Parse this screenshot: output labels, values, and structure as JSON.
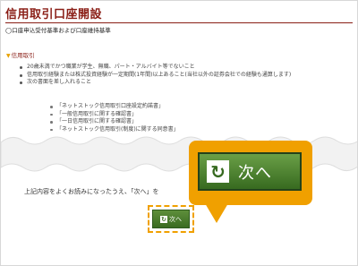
{
  "page": {
    "title": "信用取引口座開設",
    "subheading": "◯口座申込受付基準および口座維持基準"
  },
  "section": {
    "title": "信用取引",
    "marker_icon": "triangle-down-icon"
  },
  "criteria": [
    "20歳未満でかつ職業が学生、無職、パート・アルバイト等でないこと",
    "信用取引経験または株式投資経験が一定期間(1年間)以上あること(当社以外の証券会社での経験も通算します)",
    "次の書面を差し入れること"
  ],
  "documents": [
    "「ネットストック信用取引口座設定約諾書」",
    "「一般信用取引に関する確認書」",
    "「一日信用取引に関する確認書」",
    "「ネットストック信用取引(制度)に関する同意書」"
  ],
  "instruction": "上記内容をよくお読みになったうえ、「次へ」を",
  "buttons": {
    "next_small": {
      "label": "次へ",
      "icon": "arrow-return-icon"
    },
    "next_large": {
      "label": "次へ",
      "icon": "arrow-return-icon"
    }
  },
  "colors": {
    "title": "#8a1e16",
    "accent": "#f0a000",
    "button": "#3a6b22"
  }
}
